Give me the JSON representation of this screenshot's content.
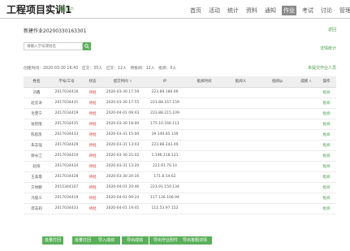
{
  "header": {
    "course_title": "工程项目实训1",
    "portal_tag": "课程门户",
    "nav": [
      "首页",
      "活动",
      "统计",
      "资料",
      "通知",
      "作业",
      "考试",
      "讨论",
      "管理"
    ],
    "active_nav": "作业"
  },
  "page": {
    "breadcrumb": "新建作业20200330163301",
    "back_link": "返回",
    "detail_link": "详情统计",
    "unsubmitted_link": "未提交作业人员"
  },
  "search": {
    "placeholder": "请输入学号或姓名"
  },
  "stats": {
    "created": "创建时间：2020-03-30 16:43",
    "should_submit": "应交：35人",
    "submitted": "已交：12人",
    "pending": "待批阅：12人",
    "reviewed": "批阅：0人"
  },
  "table": {
    "headers": [
      "姓名",
      "学号/工号",
      "状态",
      "提交时间",
      "IP",
      "批阅时间",
      "批阅人",
      "批阅ip",
      "成绩",
      "操作"
    ],
    "rows": [
      {
        "name": "刘鑫",
        "id": "2017034416",
        "status": "待批",
        "time": "2020-03-30 17:59",
        "ip": "223.89.189.06",
        "action": "批阅"
      },
      {
        "name": "赵云涛",
        "id": "2017034431",
        "status": "待批",
        "time": "2020-03-30 17:55",
        "ip": "223.88.167.159",
        "action": "批阅"
      },
      {
        "name": "毛雯宁",
        "id": "2017034419",
        "status": "待批",
        "time": "2020-04-01 09:43",
        "ip": "223.88.215.109",
        "action": "批阅"
      },
      {
        "name": "张智隆",
        "id": "2017034435",
        "status": "待批",
        "time": "2020-03-30 18:00",
        "ip": "175.10.166.111",
        "action": "批阅"
      },
      {
        "name": "陈航凯",
        "id": "2017034433",
        "status": "待批",
        "time": "2020-03-31 15:00",
        "ip": "39.149.85.139",
        "action": "批阅"
      },
      {
        "name": "朱志强",
        "id": "2017034429",
        "status": "待批",
        "time": "2020-03-31 13:03",
        "ip": "223.88.243.49",
        "action": "批阅"
      },
      {
        "name": "廖长江",
        "id": "2017034419",
        "status": "待批",
        "time": "2020-03-30 21:02",
        "ip": "1.196.218.121",
        "action": "批阅"
      },
      {
        "name": "赵阳",
        "id": "2017034434",
        "status": "待批",
        "time": "2020-03-31 13:20",
        "ip": "223.91.70.14",
        "action": "批阅"
      },
      {
        "name": "王美霞",
        "id": "2017034428",
        "status": "待批",
        "time": "2020-03-30 20:16",
        "ip": "171.8.54.62",
        "action": "批阅"
      },
      {
        "name": "方林鹏",
        "id": "2015344107",
        "status": "待批",
        "time": "2020-04-01 20:46",
        "ip": "223.91.150.134",
        "action": "批阅"
      },
      {
        "name": "冯俊义",
        "id": "2017034419",
        "status": "待批",
        "time": "2020-04-01 09:24",
        "ip": "117.136.106.94",
        "action": "批阅"
      },
      {
        "name": "席志莉",
        "id": "2017034433",
        "status": "待批",
        "time": "2020-04-01 19:45",
        "ip": "112.53.97.152",
        "action": "批阅"
      }
    ]
  },
  "actions": [
    "批量打回",
    "批量打回",
    "导入成绩",
    "导出成绩",
    "导出作业附件",
    "导出答题详情"
  ]
}
